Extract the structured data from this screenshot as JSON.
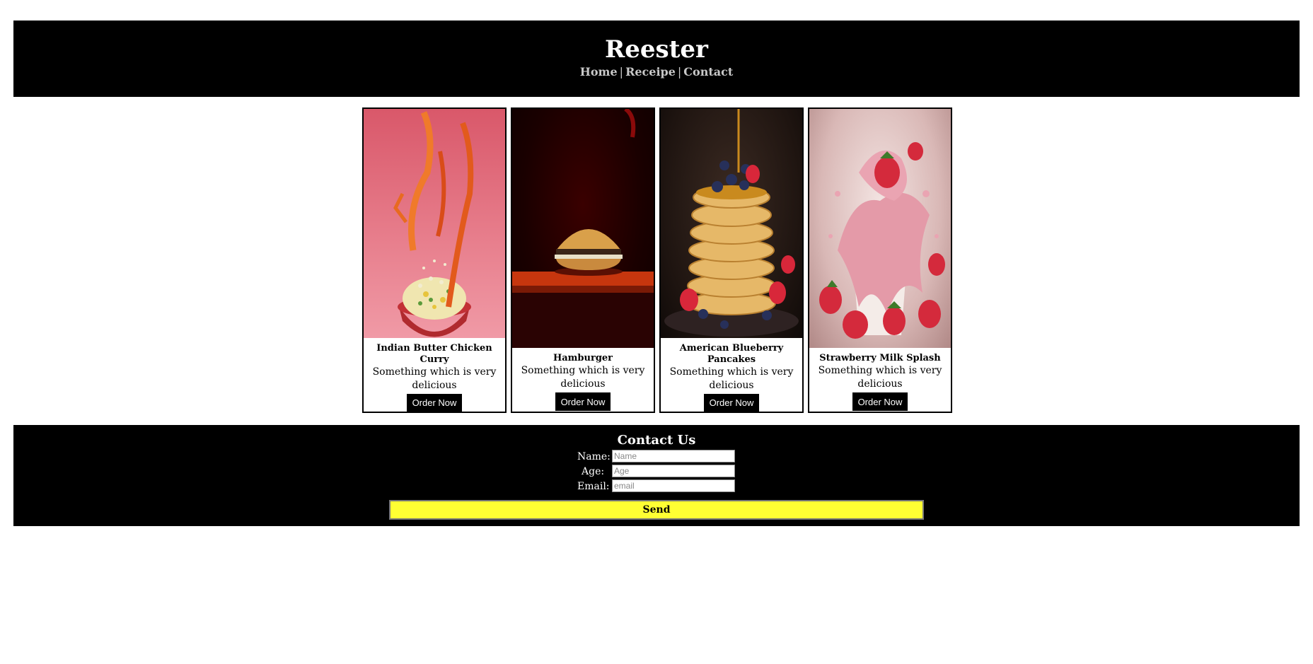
{
  "site": {
    "title": "Reester",
    "nav": [
      "Home",
      "Receipe",
      "Contact"
    ],
    "nav_separator": "|"
  },
  "cards": [
    {
      "title": "Indian Butter Chicken Curry",
      "desc": "Something which is very delicious",
      "button": "Order Now"
    },
    {
      "title": "Hamburger",
      "desc": "Something which is very delicious",
      "button": "Order Now"
    },
    {
      "title": "American Blueberry Pancakes",
      "desc": "Something which is very delicious",
      "button": "Order Now"
    },
    {
      "title": "Strawberry Milk Splash",
      "desc": "Something which is very delicious",
      "button": "Order Now"
    }
  ],
  "contact": {
    "title": "Contact Us",
    "fields": [
      {
        "label": "Name:",
        "placeholder": "Name",
        "value": ""
      },
      {
        "label": "Age:",
        "placeholder": "Age",
        "value": ""
      },
      {
        "label": "Email:",
        "placeholder": "email",
        "value": ""
      }
    ],
    "send_label": "Send"
  },
  "colors": {
    "header_bg": "#000000",
    "send_bg": "#ffff33",
    "nav_text": "#c8c8c8"
  }
}
